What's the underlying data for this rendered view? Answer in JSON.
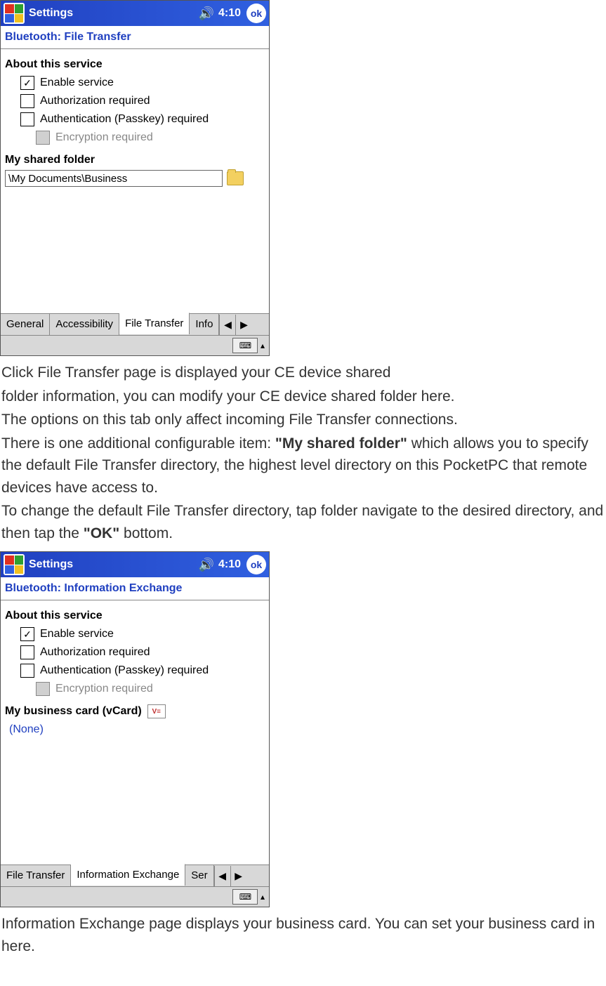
{
  "screenshot1": {
    "titlebar": {
      "app": "Settings",
      "time": "4:10",
      "ok": "ok"
    },
    "bt_header": "Bluetooth: File Transfer",
    "section_about": "About this service",
    "options": {
      "enable": "Enable service",
      "auth_req": "Authorization required",
      "authn_req": "Authentication (Passkey) required",
      "encrypt": "Encryption required"
    },
    "shared_label": "My shared folder",
    "shared_path": "\\My Documents\\Business",
    "tabs": [
      "General",
      "Accessibility",
      "File Transfer",
      "Info"
    ]
  },
  "doc_text": {
    "p1a": "Click File Transfer   page is displayed your CE device shared",
    "p1b": "folder   information, you can modify your CE device shared folder   here.",
    "p2": "The options on this tab only affect incoming File Transfer connections.",
    "p3a": "There is one additional configurable item: ",
    "p3bold": "\"My shared folder\"",
    "p3b": " which allows you to specify the default File Transfer directory, the highest level directory on this PocketPC that remote devices have access to.",
    "p4a": "To change the default File Transfer directory, tap folder navigate to the desired directory, and then tap the ",
    "p4bold": "\"OK\"",
    "p4b": " bottom."
  },
  "screenshot2": {
    "titlebar": {
      "app": "Settings",
      "time": "4:10",
      "ok": "ok"
    },
    "bt_header": "Bluetooth: Information Exchange",
    "section_about": "About this service",
    "options": {
      "enable": "Enable service",
      "auth_req": "Authorization required",
      "authn_req": "Authentication (Passkey) required",
      "encrypt": "Encryption required"
    },
    "vcard_label": "My business card (vCard)",
    "none": "(None)",
    "tabs": [
      "File Transfer",
      "Information Exchange",
      "Ser"
    ]
  },
  "doc_text2": {
    "p1": "Information Exchange page displays your business card. You can set   your business card in here."
  }
}
